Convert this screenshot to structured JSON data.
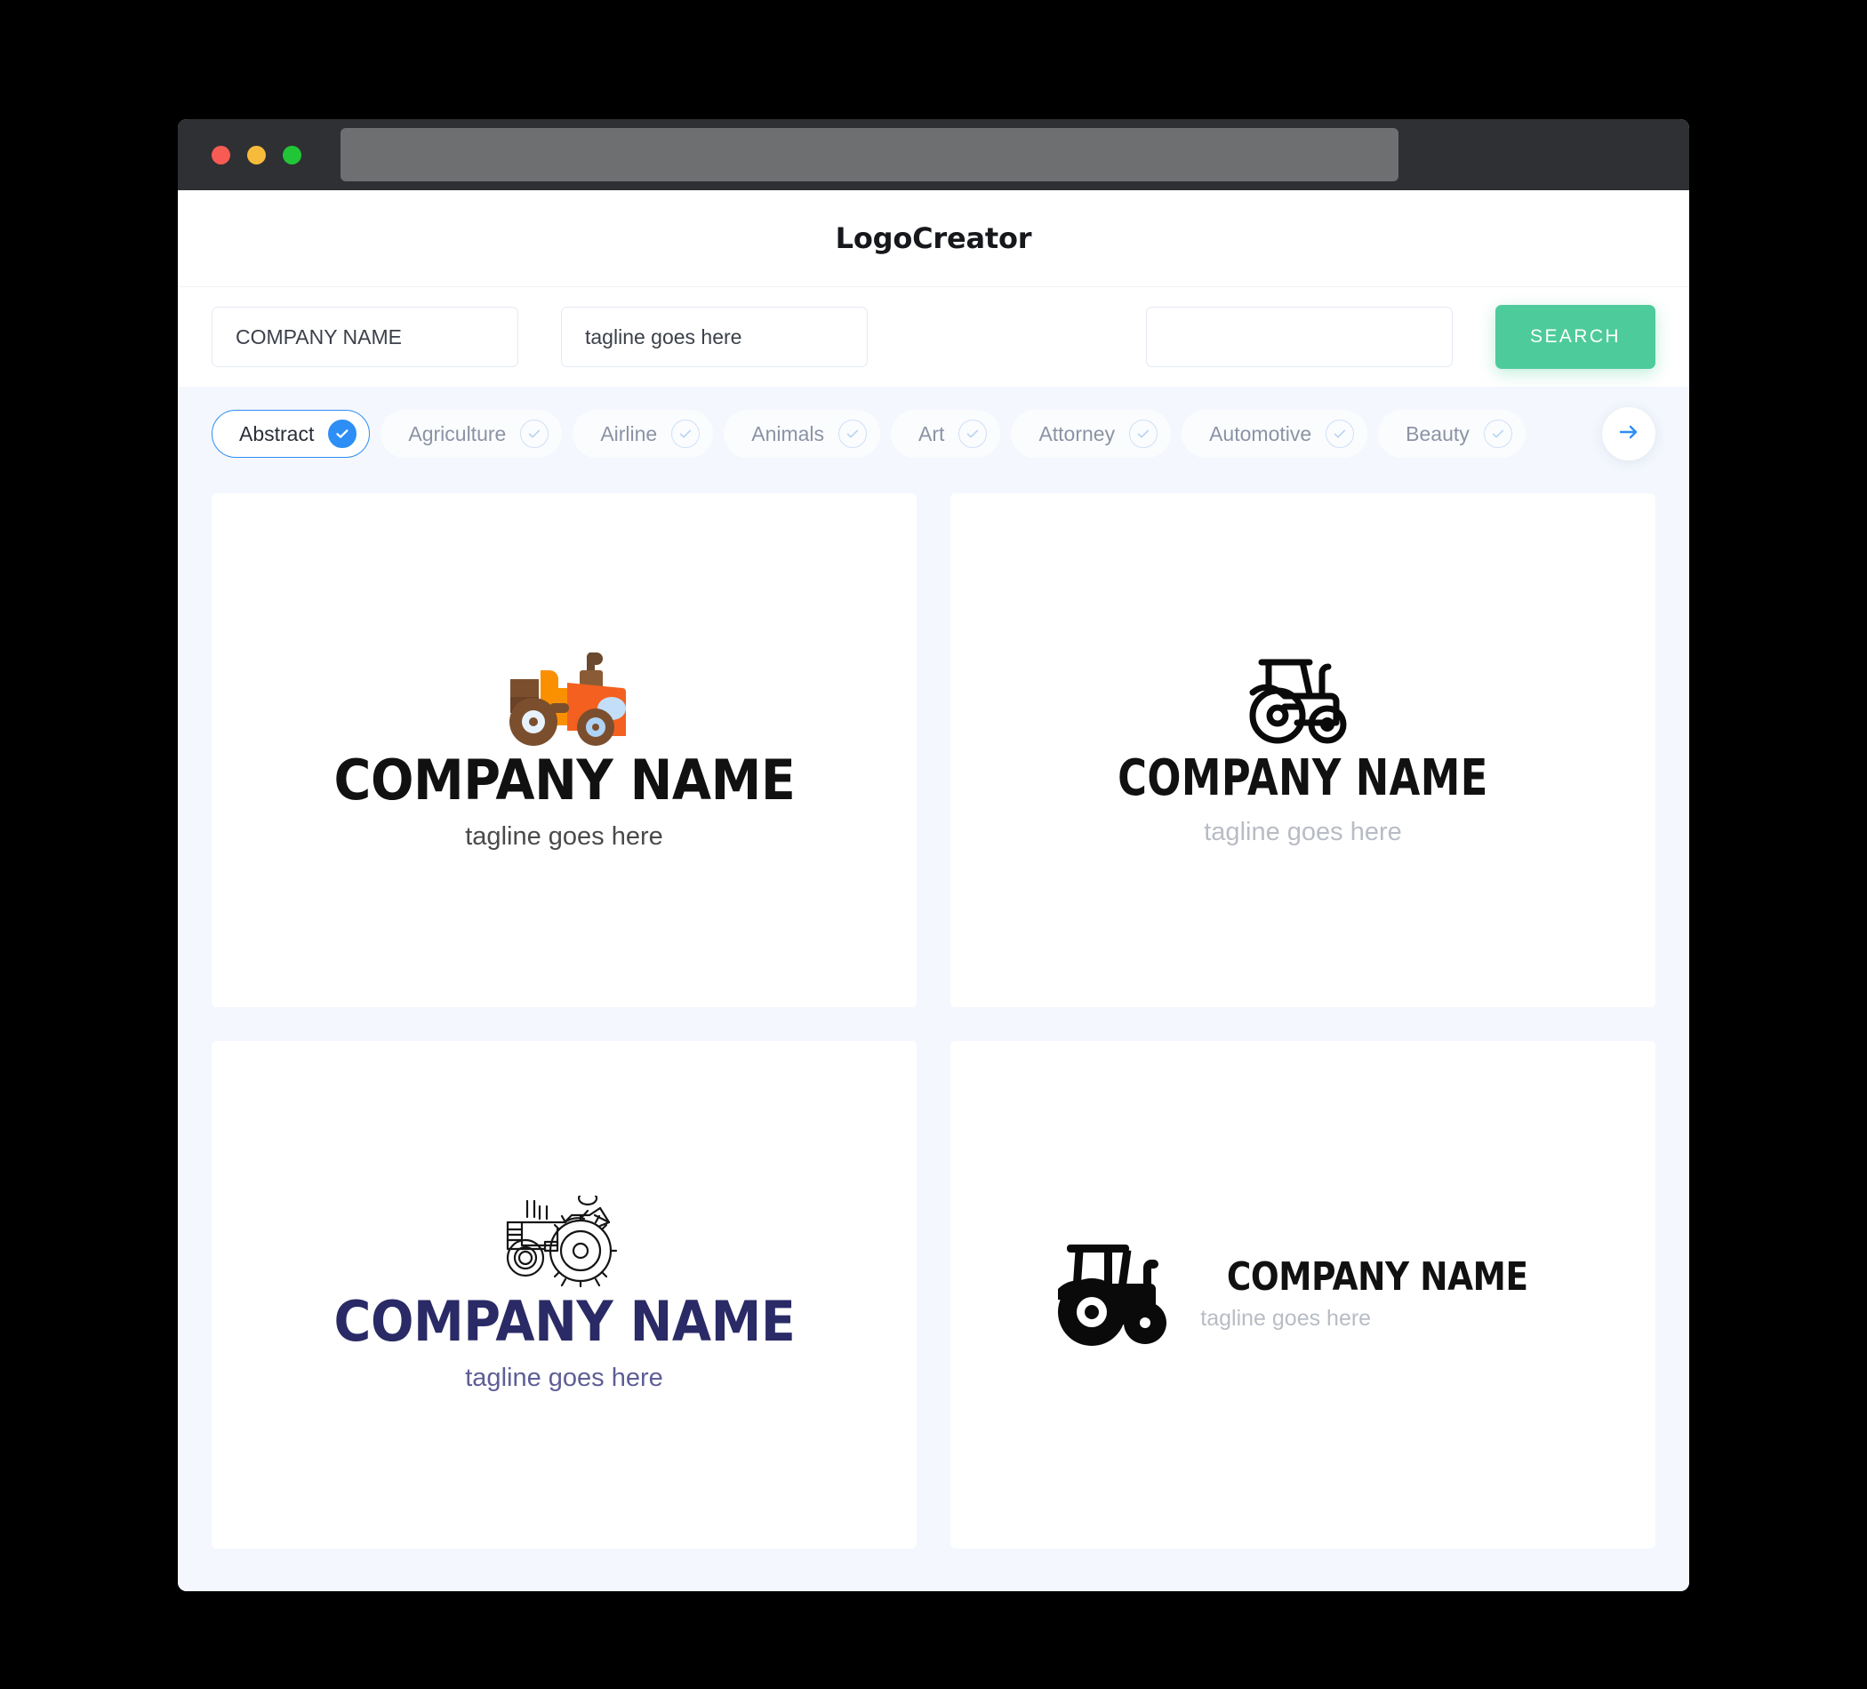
{
  "window": {
    "traffic_lights": [
      "close",
      "minimize",
      "maximize"
    ],
    "url_value": ""
  },
  "app": {
    "title": "LogoCreator"
  },
  "search": {
    "company_value": "COMPANY NAME",
    "company_placeholder": "COMPANY NAME",
    "tagline_value": "tagline goes here",
    "tagline_placeholder": "tagline goes here",
    "extra_value": "",
    "extra_placeholder": "",
    "search_button": "SEARCH",
    "button_color": "#4ecb9b"
  },
  "filters": {
    "next_arrow": "arrow-right",
    "active_color": "#2d8ef5",
    "chips": [
      {
        "label": "Abstract",
        "selected": true
      },
      {
        "label": "Agriculture",
        "selected": false
      },
      {
        "label": "Airline",
        "selected": false
      },
      {
        "label": "Animals",
        "selected": false
      },
      {
        "label": "Art",
        "selected": false
      },
      {
        "label": "Attorney",
        "selected": false
      },
      {
        "label": "Automotive",
        "selected": false
      },
      {
        "label": "Beauty",
        "selected": false
      }
    ]
  },
  "results": {
    "cards": [
      {
        "layout": "stack",
        "icon": "tractor-flat-color-icon",
        "name": "COMPANY NAME",
        "tagline": "tagline goes here",
        "name_color": "#111111",
        "tagline_color": "#4a4a4a"
      },
      {
        "layout": "stack",
        "icon": "tractor-outline-icon",
        "name": "COMPANY NAME",
        "tagline": "tagline goes here",
        "name_color": "#111111",
        "tagline_color": "#b8bcc4"
      },
      {
        "layout": "stack",
        "icon": "tractor-line-art-icon",
        "name": "COMPANY NAME",
        "tagline": "tagline goes here",
        "name_color": "#2a2a66",
        "tagline_color": "#5e5e96"
      },
      {
        "layout": "row",
        "icon": "tractor-solid-icon",
        "name": "COMPANY NAME",
        "tagline": "tagline goes here",
        "name_color": "#111111",
        "tagline_color": "#b8bcc4"
      }
    ]
  }
}
